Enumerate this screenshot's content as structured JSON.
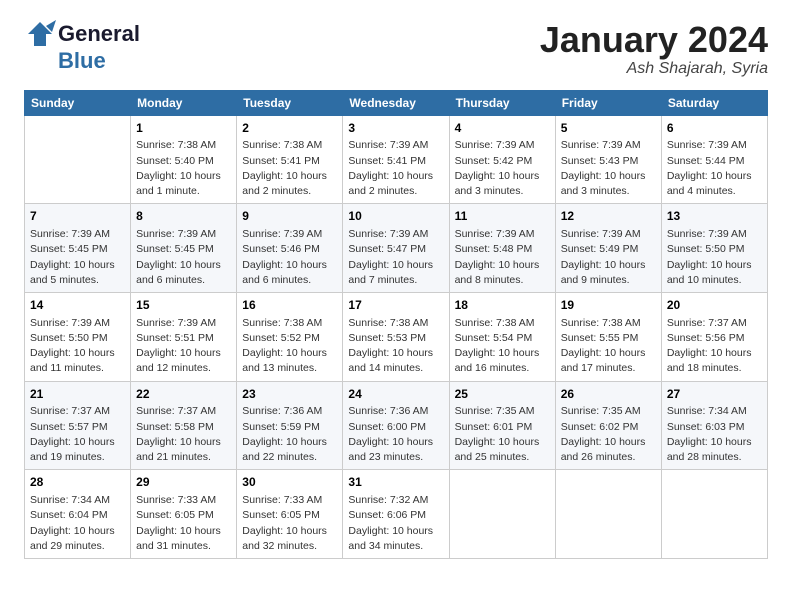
{
  "header": {
    "logo_line1": "General",
    "logo_line2": "Blue",
    "month_title": "January 2024",
    "location": "Ash Shajarah, Syria"
  },
  "weekdays": [
    "Sunday",
    "Monday",
    "Tuesday",
    "Wednesday",
    "Thursday",
    "Friday",
    "Saturday"
  ],
  "weeks": [
    [
      {
        "day": "",
        "info": ""
      },
      {
        "day": "1",
        "info": "Sunrise: 7:38 AM\nSunset: 5:40 PM\nDaylight: 10 hours\nand 1 minute."
      },
      {
        "day": "2",
        "info": "Sunrise: 7:38 AM\nSunset: 5:41 PM\nDaylight: 10 hours\nand 2 minutes."
      },
      {
        "day": "3",
        "info": "Sunrise: 7:39 AM\nSunset: 5:41 PM\nDaylight: 10 hours\nand 2 minutes."
      },
      {
        "day": "4",
        "info": "Sunrise: 7:39 AM\nSunset: 5:42 PM\nDaylight: 10 hours\nand 3 minutes."
      },
      {
        "day": "5",
        "info": "Sunrise: 7:39 AM\nSunset: 5:43 PM\nDaylight: 10 hours\nand 3 minutes."
      },
      {
        "day": "6",
        "info": "Sunrise: 7:39 AM\nSunset: 5:44 PM\nDaylight: 10 hours\nand 4 minutes."
      }
    ],
    [
      {
        "day": "7",
        "info": "Sunrise: 7:39 AM\nSunset: 5:45 PM\nDaylight: 10 hours\nand 5 minutes."
      },
      {
        "day": "8",
        "info": "Sunrise: 7:39 AM\nSunset: 5:45 PM\nDaylight: 10 hours\nand 6 minutes."
      },
      {
        "day": "9",
        "info": "Sunrise: 7:39 AM\nSunset: 5:46 PM\nDaylight: 10 hours\nand 6 minutes."
      },
      {
        "day": "10",
        "info": "Sunrise: 7:39 AM\nSunset: 5:47 PM\nDaylight: 10 hours\nand 7 minutes."
      },
      {
        "day": "11",
        "info": "Sunrise: 7:39 AM\nSunset: 5:48 PM\nDaylight: 10 hours\nand 8 minutes."
      },
      {
        "day": "12",
        "info": "Sunrise: 7:39 AM\nSunset: 5:49 PM\nDaylight: 10 hours\nand 9 minutes."
      },
      {
        "day": "13",
        "info": "Sunrise: 7:39 AM\nSunset: 5:50 PM\nDaylight: 10 hours\nand 10 minutes."
      }
    ],
    [
      {
        "day": "14",
        "info": "Sunrise: 7:39 AM\nSunset: 5:50 PM\nDaylight: 10 hours\nand 11 minutes."
      },
      {
        "day": "15",
        "info": "Sunrise: 7:39 AM\nSunset: 5:51 PM\nDaylight: 10 hours\nand 12 minutes."
      },
      {
        "day": "16",
        "info": "Sunrise: 7:38 AM\nSunset: 5:52 PM\nDaylight: 10 hours\nand 13 minutes."
      },
      {
        "day": "17",
        "info": "Sunrise: 7:38 AM\nSunset: 5:53 PM\nDaylight: 10 hours\nand 14 minutes."
      },
      {
        "day": "18",
        "info": "Sunrise: 7:38 AM\nSunset: 5:54 PM\nDaylight: 10 hours\nand 16 minutes."
      },
      {
        "day": "19",
        "info": "Sunrise: 7:38 AM\nSunset: 5:55 PM\nDaylight: 10 hours\nand 17 minutes."
      },
      {
        "day": "20",
        "info": "Sunrise: 7:37 AM\nSunset: 5:56 PM\nDaylight: 10 hours\nand 18 minutes."
      }
    ],
    [
      {
        "day": "21",
        "info": "Sunrise: 7:37 AM\nSunset: 5:57 PM\nDaylight: 10 hours\nand 19 minutes."
      },
      {
        "day": "22",
        "info": "Sunrise: 7:37 AM\nSunset: 5:58 PM\nDaylight: 10 hours\nand 21 minutes."
      },
      {
        "day": "23",
        "info": "Sunrise: 7:36 AM\nSunset: 5:59 PM\nDaylight: 10 hours\nand 22 minutes."
      },
      {
        "day": "24",
        "info": "Sunrise: 7:36 AM\nSunset: 6:00 PM\nDaylight: 10 hours\nand 23 minutes."
      },
      {
        "day": "25",
        "info": "Sunrise: 7:35 AM\nSunset: 6:01 PM\nDaylight: 10 hours\nand 25 minutes."
      },
      {
        "day": "26",
        "info": "Sunrise: 7:35 AM\nSunset: 6:02 PM\nDaylight: 10 hours\nand 26 minutes."
      },
      {
        "day": "27",
        "info": "Sunrise: 7:34 AM\nSunset: 6:03 PM\nDaylight: 10 hours\nand 28 minutes."
      }
    ],
    [
      {
        "day": "28",
        "info": "Sunrise: 7:34 AM\nSunset: 6:04 PM\nDaylight: 10 hours\nand 29 minutes."
      },
      {
        "day": "29",
        "info": "Sunrise: 7:33 AM\nSunset: 6:05 PM\nDaylight: 10 hours\nand 31 minutes."
      },
      {
        "day": "30",
        "info": "Sunrise: 7:33 AM\nSunset: 6:05 PM\nDaylight: 10 hours\nand 32 minutes."
      },
      {
        "day": "31",
        "info": "Sunrise: 7:32 AM\nSunset: 6:06 PM\nDaylight: 10 hours\nand 34 minutes."
      },
      {
        "day": "",
        "info": ""
      },
      {
        "day": "",
        "info": ""
      },
      {
        "day": "",
        "info": ""
      }
    ]
  ]
}
